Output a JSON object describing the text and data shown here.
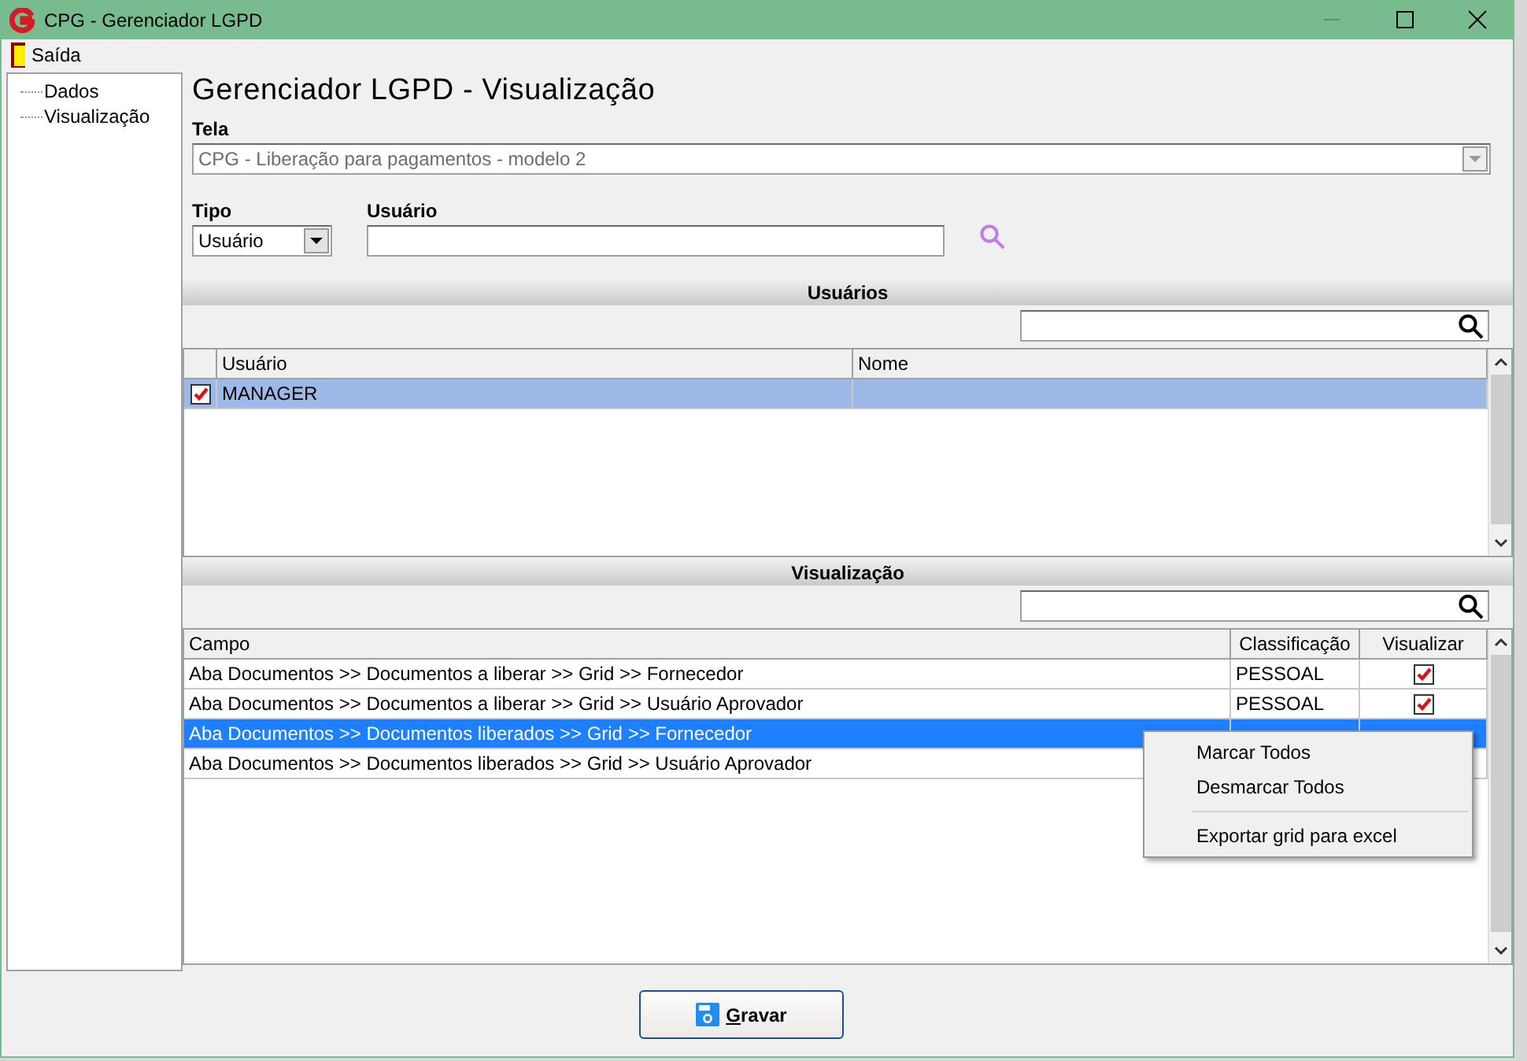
{
  "window": {
    "title": "CPG - Gerenciador LGPD"
  },
  "menu": [
    {
      "label": "Saída"
    }
  ],
  "tree": {
    "items": [
      {
        "label": "Dados"
      },
      {
        "label": "Visualização"
      }
    ]
  },
  "heading": "Gerenciador LGPD - Visualização",
  "tela": {
    "label": "Tela",
    "value": "CPG - Liberação para pagamentos - modelo 2",
    "disabled": true
  },
  "tipo": {
    "label": "Tipo",
    "value": "Usuário"
  },
  "usuario": {
    "label": "Usuário"
  },
  "usuarios": {
    "title": "Usuários",
    "columns": [
      "Usuário",
      "Nome"
    ],
    "rows": [
      {
        "usuario": "MANAGER",
        "checked": true,
        "selected": true
      }
    ]
  },
  "visualizacao": {
    "title": "Visualização",
    "columns": [
      "Campo",
      "Classificação",
      "Visualizar"
    ],
    "rows": [
      {
        "campo": "Aba Documentos >> Documentos a liberar >> Grid >> Fornecedor",
        "classificacao": "PESSOAL",
        "checked": true,
        "selected": false
      },
      {
        "campo": "Aba Documentos >> Documentos a liberar >> Grid >> Usuário Aprovador",
        "classificacao": "PESSOAL",
        "checked": true,
        "selected": false
      },
      {
        "campo": "Aba Documentos >> Documentos liberados >> Grid >> Fornecedor",
        "selected": true
      },
      {
        "campo": "Aba Documentos >> Documentos liberados >> Grid >> Usuário Aprovador",
        "selected": false
      }
    ]
  },
  "context_menu": {
    "groups": [
      [
        {
          "label": "Marcar Todos"
        },
        {
          "label": "Desmarcar Todos"
        }
      ],
      [
        {
          "label": "Exportar grid para excel"
        }
      ]
    ]
  },
  "save_button": {
    "label": "Gravar"
  }
}
